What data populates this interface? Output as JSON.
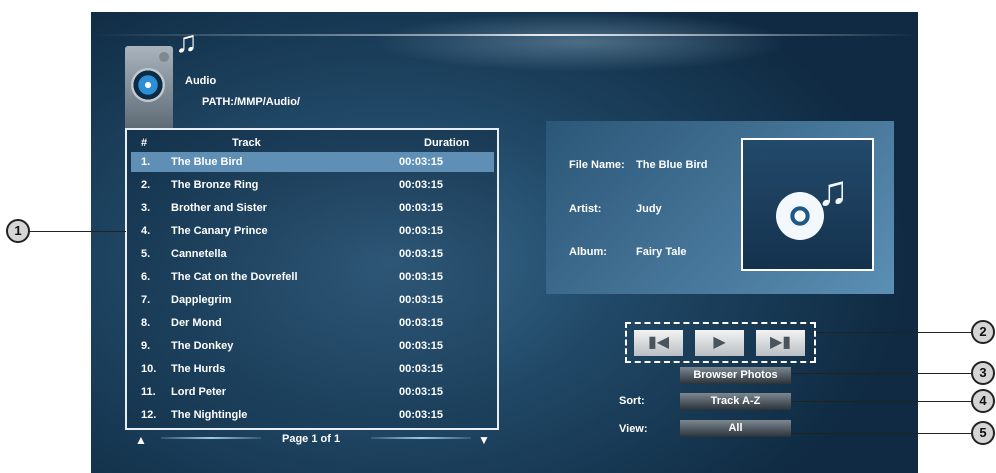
{
  "header": {
    "title": "Audio",
    "path": "PATH:/MMP/Audio/",
    "media_icon": "speaker-icon",
    "note_icon": "music-note-icon"
  },
  "track_list": {
    "columns": [
      "#",
      "Track",
      "Duration"
    ],
    "rows": [
      {
        "num": "1.",
        "track": "The Blue Bird",
        "duration": "00:03:15"
      },
      {
        "num": "2.",
        "track": "The Bronze Ring",
        "duration": "00:03:15"
      },
      {
        "num": "3.",
        "track": "Brother and Sister",
        "duration": "00:03:15"
      },
      {
        "num": "4.",
        "track": "The Canary Prince",
        "duration": "00:03:15"
      },
      {
        "num": "5.",
        "track": "Cannetella",
        "duration": "00:03:15"
      },
      {
        "num": "6.",
        "track": "The Cat on the Dovrefell",
        "duration": "00:03:15"
      },
      {
        "num": "7.",
        "track": "Dapplegrim",
        "duration": "00:03:15"
      },
      {
        "num": "8.",
        "track": "Der Mond",
        "duration": "00:03:15"
      },
      {
        "num": "9.",
        "track": "The Donkey",
        "duration": "00:03:15"
      },
      {
        "num": "10.",
        "track": "The Hurds",
        "duration": "00:03:15"
      },
      {
        "num": "11.",
        "track": "Lord Peter",
        "duration": "00:03:15"
      },
      {
        "num": "12.",
        "track": "The Nightingle",
        "duration": "00:03:15"
      }
    ],
    "selected_index": 0
  },
  "pager": {
    "label": "Page 1 of 1",
    "up_icon": "triangle-up-icon",
    "down_icon": "triangle-down-icon"
  },
  "info": {
    "file_name_label": "File Name:",
    "file_name": "The Blue Bird",
    "artist_label": "Artist:",
    "artist": "Judy",
    "album_label": "Album:",
    "album": "Fairy Tale"
  },
  "controls": {
    "prev_icon": "skip-previous-icon",
    "play_icon": "play-icon",
    "next_icon": "skip-next-icon"
  },
  "options": {
    "browser_button": "Browser Photos",
    "sort_label": "Sort:",
    "sort_value": "Track A-Z",
    "view_label": "View:",
    "view_value": "All"
  },
  "callouts": [
    "1",
    "2",
    "3",
    "4",
    "5"
  ],
  "colors": {
    "selection": "#5f8fb5",
    "background": "#1b4260"
  }
}
